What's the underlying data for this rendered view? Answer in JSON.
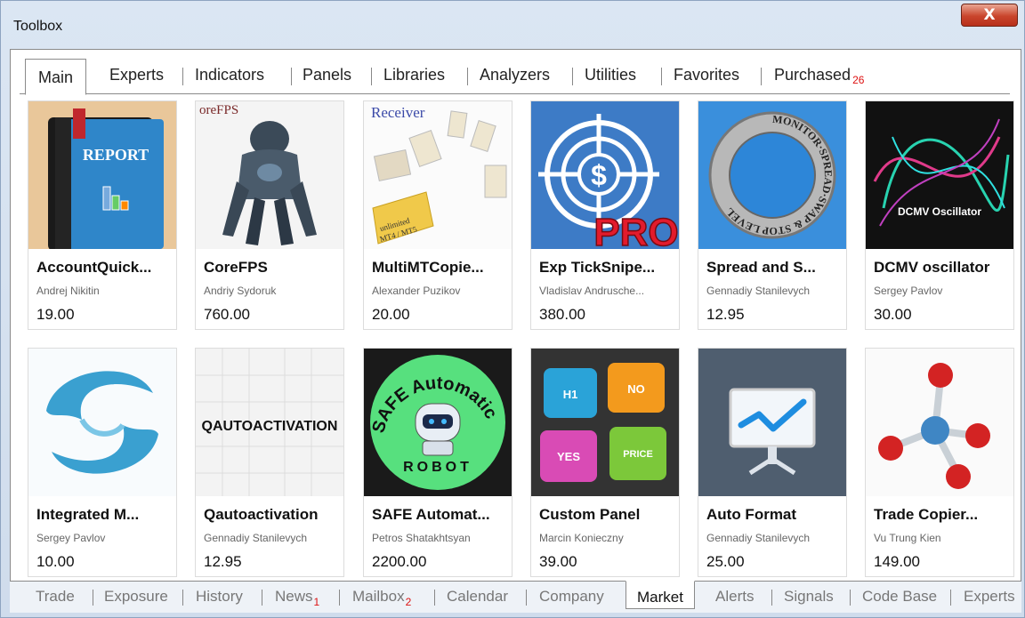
{
  "window": {
    "title": "Toolbox",
    "close_label": "X"
  },
  "top_tabs": [
    {
      "label": "Main",
      "active": true
    },
    {
      "label": "Experts"
    },
    {
      "label": "Indicators"
    },
    {
      "label": "Panels"
    },
    {
      "label": "Libraries"
    },
    {
      "label": "Analyzers"
    },
    {
      "label": "Utilities"
    },
    {
      "label": "Favorites"
    },
    {
      "label": "Purchased",
      "badge": "26"
    }
  ],
  "products": [
    {
      "name": "AccountQuick...",
      "author": "Andrej Nikitin",
      "price": "19.00",
      "icon": "report-book-icon",
      "thumb_text": "REPORT"
    },
    {
      "name": "CoreFPS",
      "author": "Andriy Sydoruk",
      "price": "760.00",
      "icon": "sprinter-robot-icon",
      "thumb_text": "oreFPS"
    },
    {
      "name": "MultiMTCopie...",
      "author": "Alexander Puzikov",
      "price": "20.00",
      "icon": "receiver-files-icon",
      "thumb_text": "Receiver"
    },
    {
      "name": "Exp TickSnipe...",
      "author": "Vladislav Andrusche...",
      "price": "380.00",
      "icon": "dollar-target-icon",
      "thumb_text": "PRO"
    },
    {
      "name": "Spread and S...",
      "author": "Gennadiy Stanilevych",
      "price": "12.95",
      "icon": "spread-monitor-ring-icon",
      "thumb_text": "MONITOR·SPREAD·SWAP & STOP LEVEL"
    },
    {
      "name": "DCMV oscillator",
      "author": "Sergey Pavlov",
      "price": "30.00",
      "icon": "oscillator-waves-icon",
      "thumb_text": "DCMV Oscillator"
    },
    {
      "name": "Integrated M...",
      "author": "Sergey Pavlov",
      "price": "10.00",
      "icon": "swirl-icon",
      "thumb_text": ""
    },
    {
      "name": "Qautoactivation",
      "author": "Gennadiy Stanilevych",
      "price": "12.95",
      "icon": "qautoactivation-label-icon",
      "thumb_text": "QAUTOACTIVATION"
    },
    {
      "name": "SAFE Automat...",
      "author": "Petros Shatakhtsyan",
      "price": "2200.00",
      "icon": "safe-robot-icon",
      "thumb_text": "SAFE Automatic ROBOT"
    },
    {
      "name": "Custom Panel",
      "author": "Marcin Konieczny",
      "price": "39.00",
      "icon": "puzzle-pieces-icon",
      "thumb_text": "H1 NO YES PRICE"
    },
    {
      "name": "Auto Format",
      "author": "Gennadiy Stanilevych",
      "price": "25.00",
      "icon": "presentation-chart-icon",
      "thumb_text": ""
    },
    {
      "name": "Trade Copier...",
      "author": "Vu Trung Kien",
      "price": "149.00",
      "icon": "molecule-icon",
      "thumb_text": ""
    }
  ],
  "bottom_tabs": [
    {
      "label": "Trade"
    },
    {
      "label": "Exposure"
    },
    {
      "label": "History"
    },
    {
      "label": "News",
      "badge": "1"
    },
    {
      "label": "Mailbox",
      "badge": "2"
    },
    {
      "label": "Calendar"
    },
    {
      "label": "Company"
    },
    {
      "label": "Market",
      "active": true
    },
    {
      "label": "Alerts"
    },
    {
      "label": "Signals"
    },
    {
      "label": "Code Base"
    },
    {
      "label": "Experts"
    }
  ]
}
